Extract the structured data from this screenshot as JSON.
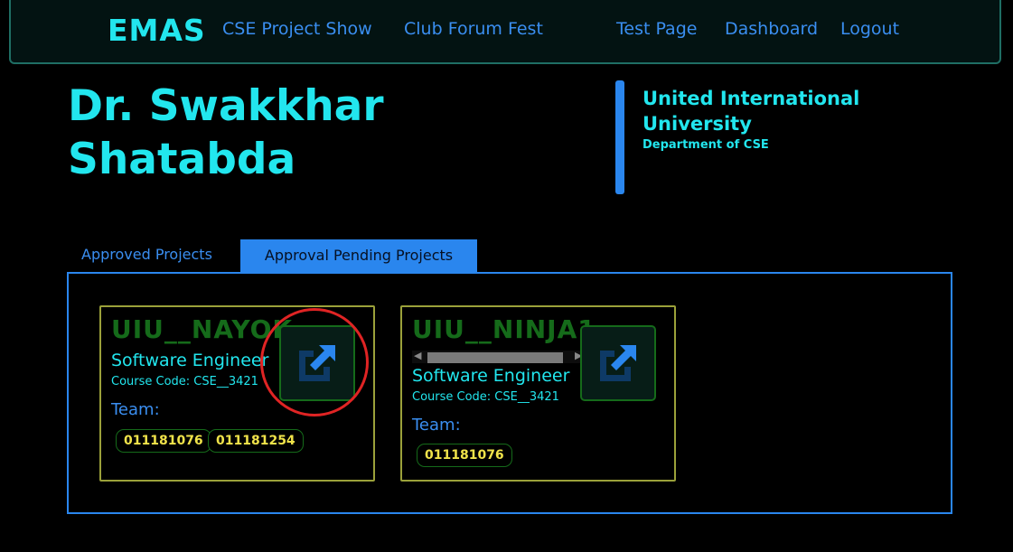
{
  "navbar": {
    "brand": "EMAS",
    "links": [
      "CSE Project Show",
      "Club Forum Fest",
      "Test Page",
      "Dashboard",
      "Logout"
    ]
  },
  "profile": {
    "name": "Dr. Swakkhar Shatabda",
    "university": "United International University",
    "department": "Department of CSE"
  },
  "tabs": [
    {
      "label": "Approved Projects",
      "active": false
    },
    {
      "label": "Approval Pending Projects",
      "active": true
    }
  ],
  "projects": [
    {
      "team": "UIU__NAYOK",
      "course": "Software Engineer",
      "course_code": "Course Code: CSE__3421",
      "team_label": "Team:",
      "members": [
        "011181076",
        "011181254"
      ]
    },
    {
      "team": "UIU__NINJA1",
      "course": "Software Engineer",
      "course_code": "Course Code: CSE__3421",
      "team_label": "Team:",
      "members": [
        "011181076"
      ]
    }
  ],
  "colors": {
    "accent_cyan": "#22e6ee",
    "accent_blue": "#2a86ee",
    "team_green": "#156b1a",
    "badge_yellow": "#f0e34a",
    "card_border": "#9ba13a",
    "annotation_red": "#e02424"
  },
  "icons": {
    "open_project": "external-link-icon"
  }
}
